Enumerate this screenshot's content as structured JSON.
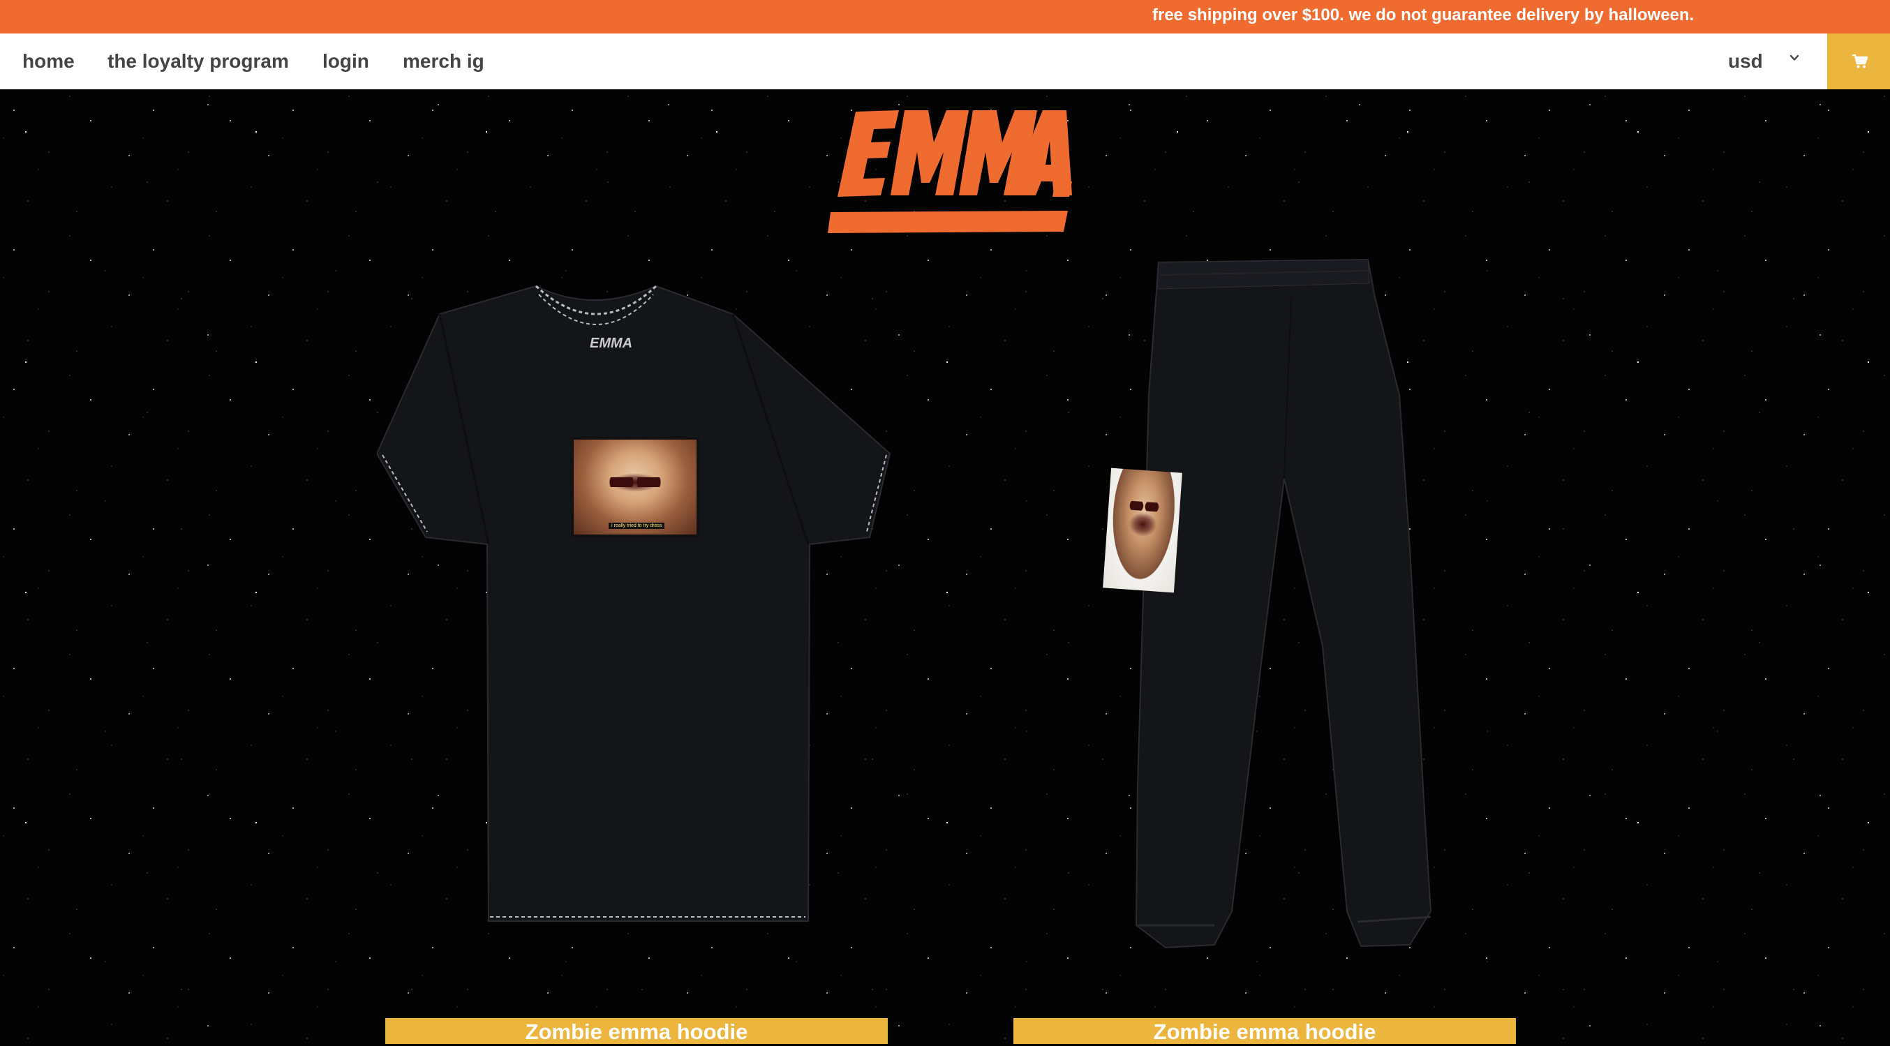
{
  "announcement": "free shipping over $100. we do not guarantee delivery by halloween.",
  "nav": {
    "items": [
      {
        "label": "home"
      },
      {
        "label": "the loyalty program"
      },
      {
        "label": "login"
      },
      {
        "label": "merch ig"
      }
    ],
    "currency": "usd",
    "cart_icon": "cart-icon"
  },
  "logo_text": "EMMA.",
  "products": [
    {
      "name": "Zombie emma hoodie",
      "image": "black t-shirt with zombie emma photo print",
      "caption": "i really tried to try dress"
    },
    {
      "name": "Zombie emma hoodie",
      "image": "black sweatpants with zombie emma photo print"
    }
  ],
  "colors": {
    "announcement_bg": "#ef6b2f",
    "logo": "#ef6b2f",
    "accent": "#ecb53d",
    "background": "#000000"
  }
}
